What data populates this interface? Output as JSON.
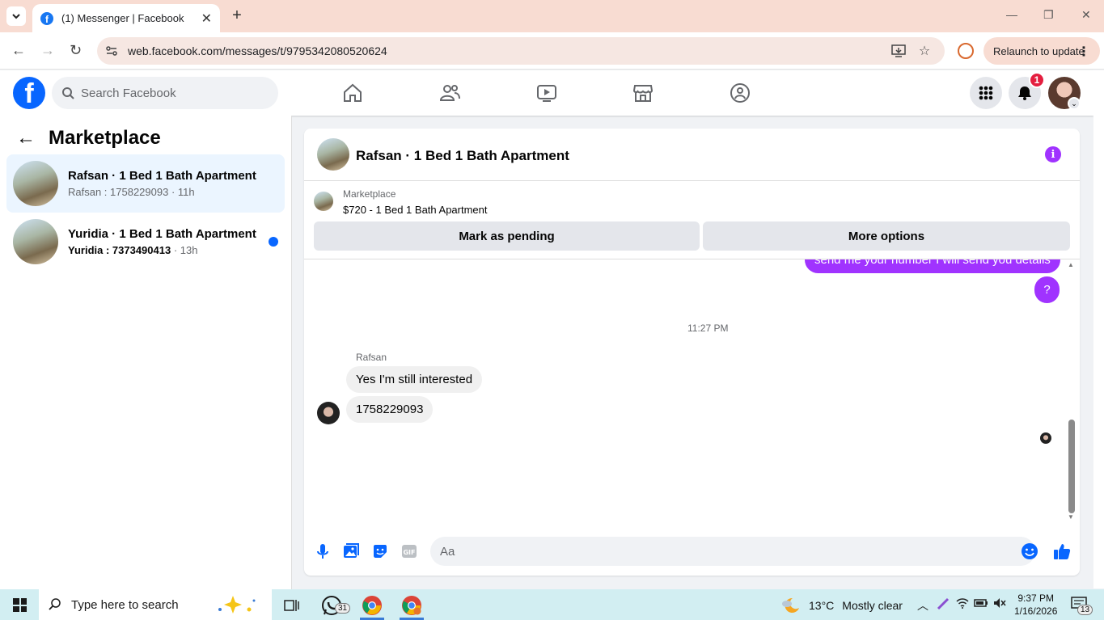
{
  "browser": {
    "tab_title": "(1) Messenger | Facebook",
    "url": "web.facebook.com/messages/t/9795342080520624",
    "relaunch_label": "Relaunch to update"
  },
  "fb_header": {
    "search_placeholder": "Search Facebook",
    "notification_count": "1"
  },
  "sidebar": {
    "title": "Marketplace",
    "conversations": [
      {
        "name": "Rafsan · 1 Bed 1 Bath Apartment",
        "preview": "Rafsan : 1758229093",
        "time": " · 11h",
        "active": true,
        "unread": false
      },
      {
        "name": "Yuridia · 1 Bed 1 Bath Apartment",
        "preview": "Yuridia : 7373490413",
        "time": " · 13h",
        "active": false,
        "unread": true
      }
    ]
  },
  "chat": {
    "title": "Rafsan · 1 Bed 1 Bath Apartment",
    "listing": {
      "category": "Marketplace",
      "item": "$720 - 1 Bed 1 Bath Apartment",
      "mark_pending_label": "Mark as pending",
      "more_options_label": "More options"
    },
    "messages": {
      "outgoing_1": "send me your number I will send you details",
      "outgoing_2": "?",
      "timestamp": "11:27 PM",
      "sender": "Rafsan",
      "incoming_1": "Yes I'm still interested",
      "incoming_2": "1758229093"
    },
    "composer_placeholder": "Aa"
  },
  "taskbar": {
    "search_placeholder": "Type here to search",
    "whatsapp_badge": "31",
    "weather_temp": "13°C",
    "weather_desc": "Mostly clear",
    "time": "9:37 PM",
    "date": "1/16/2026",
    "notifications_count": "13"
  },
  "colors": {
    "facebook_blue": "#0866ff",
    "messenger_purple": "#a033ff",
    "notification_red": "#e41e3f",
    "browser_frame": "#f8dcd2"
  }
}
